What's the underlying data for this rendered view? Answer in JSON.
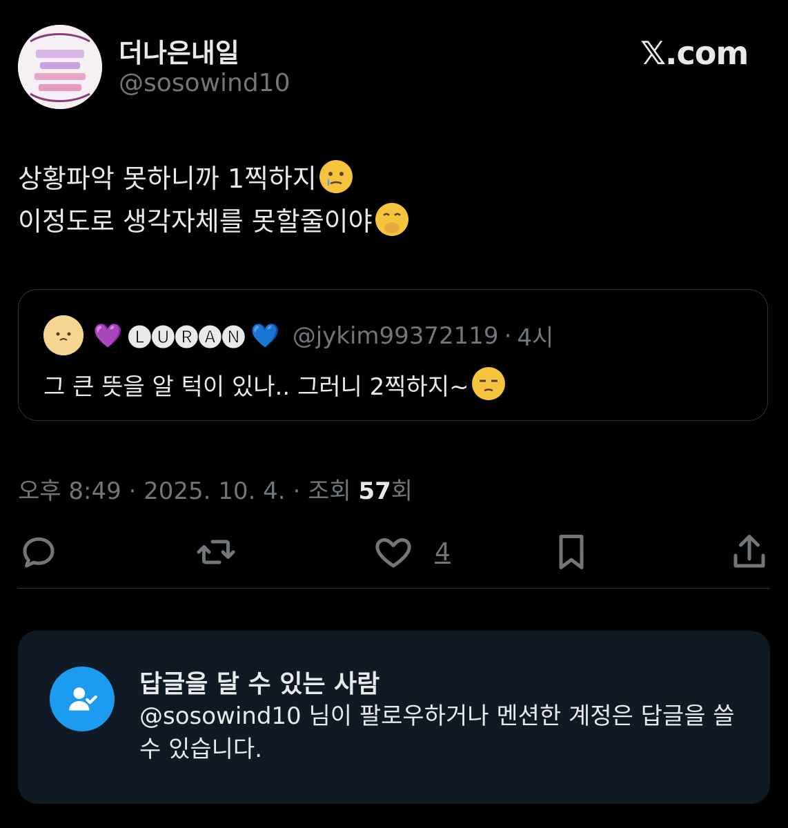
{
  "author": {
    "display_name": "더나은내일",
    "handle": "@sosowind10"
  },
  "brand": "𝕏.com",
  "tweet": {
    "line1": "상황파악 못하니까 1찍하지",
    "line2": "이정도로 생각자체를 못할줄이야",
    "emoji1": "face-holding-back-tears",
    "emoji2": "face-with-hand-over-mouth"
  },
  "quote": {
    "name_prefix_emoji": "💜",
    "name": "🅛🅤🅡🅐🅝",
    "name_suffix_emoji": "💙",
    "handle": "@jykim99372119",
    "separator": "·",
    "time": "4시",
    "text": "그 큰 뜻을 알 턱이 있나.. 그러니 2찍하지~",
    "emoji": "unamused-face"
  },
  "meta": {
    "time": "오후 8:49",
    "date": "2025. 10. 4.",
    "views_label": "조회",
    "views_count": "57",
    "views_suffix": "회",
    "sep": "·"
  },
  "actions": {
    "like_count": "4"
  },
  "reply_restriction": {
    "title": "답글을 달 수 있는 사람",
    "description": "@sosowind10 님이 팔로우하거나 멘션한 계정은 답글을 쓸 수 있습니다."
  },
  "colors": {
    "background": "#000000",
    "text": "#e7e9ea",
    "muted": "#71767b",
    "accent": "#1d9bf0",
    "panel": "#0f1a24"
  }
}
